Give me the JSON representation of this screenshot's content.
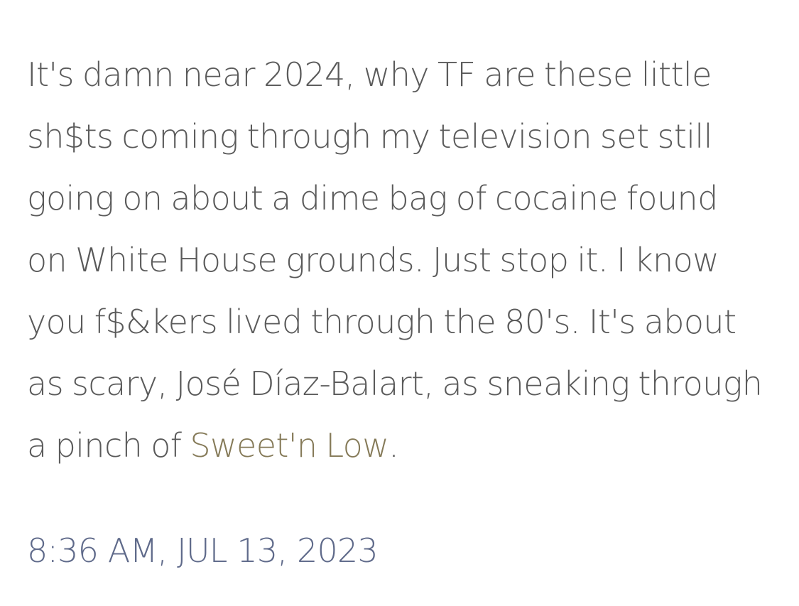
{
  "post": {
    "lines": [
      "It's damn near 2024, why TF are these little",
      "sh$ts coming through my television set still",
      "going on about a dime bag of cocaine found",
      "on White House grounds. Just stop it. I know",
      "you f$&kers lived through the 80's. It's about",
      "as scary, José Díaz-Balart, as sneaking through"
    ],
    "last_line_prefix": "a pinch of ",
    "highlight_text": "Sweet'n Low",
    "last_line_suffix": "."
  },
  "timestamp": "8:36 AM, JUL 13, 2023",
  "colors": {
    "text": "#5a5a5a",
    "highlight_background": "#fdf1c4",
    "highlight_text": "#857a58",
    "timestamp": "#5f6a8a"
  }
}
